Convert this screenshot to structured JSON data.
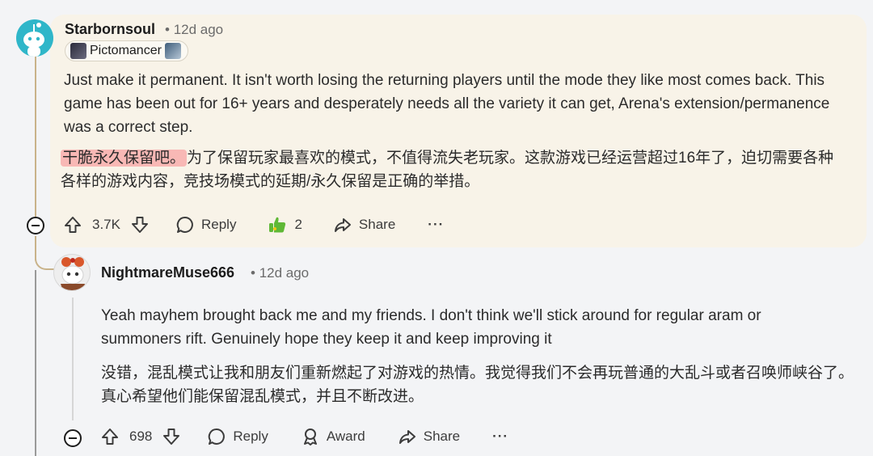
{
  "comments": [
    {
      "username": "Starbornsoul",
      "time": "12d ago",
      "flair": "Pictomancer",
      "body_en": "Just make it permanent. It isn't worth losing the returning players until the mode they like most comes back. This game has been out for 16+ years and desperately needs all the variety it can get, Arena's extension/permanence was a correct step.",
      "body_zh_highlight": "干脆永久保留吧。",
      "body_zh_rest": "为了保留玩家最喜欢的模式，不值得流失老玩家。这款游戏已经运营超过16年了，迫切需要各种各样的游戏内容，竞技场模式的延期/永久保留是正确的举措。",
      "votes": "3.7K",
      "reply_label": "Reply",
      "award_count": "2",
      "share_label": "Share",
      "more_label": "···"
    },
    {
      "username": "NightmareMuse666",
      "time": "12d ago",
      "body_en": "Yeah mayhem brought back me and my friends. I don't think we'll stick around for regular aram or summoners rift. Genuinely hope they keep it and keep improving it",
      "body_zh": "没错，混乱模式让我和朋友们重新燃起了对游戏的热情。我觉得我们不会再玩普通的大乱斗或者召唤师峡谷了。真心希望他们能保留混乱模式，并且不断改进。",
      "votes": "698",
      "reply_label": "Reply",
      "award_label": "Award",
      "share_label": "Share",
      "more_label": "···"
    }
  ],
  "meta_separator": "•",
  "colors": {
    "highlight_card": "#f8f3e8",
    "thread_line": "#c9b38a",
    "zh_highlight": "#f8b8b5",
    "award_icon": "#5fb836"
  }
}
